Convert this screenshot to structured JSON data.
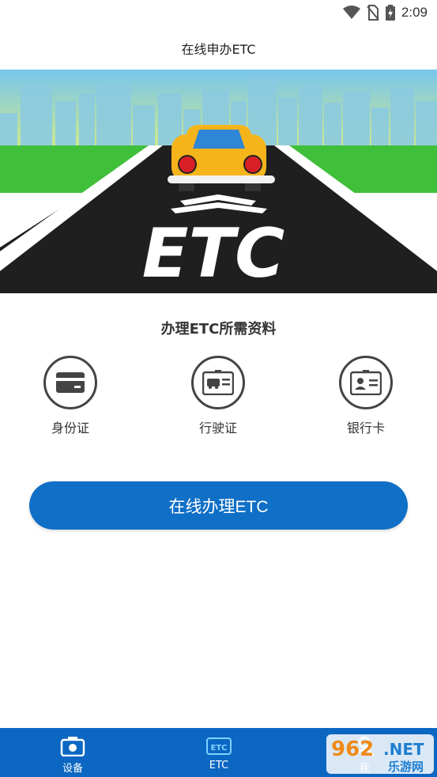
{
  "status_bar": {
    "time": "2:09"
  },
  "header": {
    "title": "在线申办ETC"
  },
  "banner": {
    "road_text": "ETC"
  },
  "requirements": {
    "title": "办理ETC所需资料",
    "items": [
      {
        "label": "身份证",
        "icon": "id-card-icon"
      },
      {
        "label": "行驶证",
        "icon": "driving-license-icon"
      },
      {
        "label": "银行卡",
        "icon": "bank-card-icon"
      }
    ]
  },
  "actions": {
    "apply_label": "在线办理ETC"
  },
  "bottom_nav": {
    "items": [
      {
        "label": "设备",
        "icon": "camera-icon"
      },
      {
        "label": "ETC",
        "icon": "etc-icon"
      },
      {
        "label": "我",
        "icon": "user-icon"
      }
    ]
  },
  "watermark": {
    "number": "962",
    "suffix": ".NET",
    "text": "乐游网"
  },
  "colors": {
    "primary": "#106fc6",
    "nav": "#0b67c2",
    "sky": "#7cc8ee",
    "grass": "#3fbf3a",
    "car": "#f6b41b"
  }
}
